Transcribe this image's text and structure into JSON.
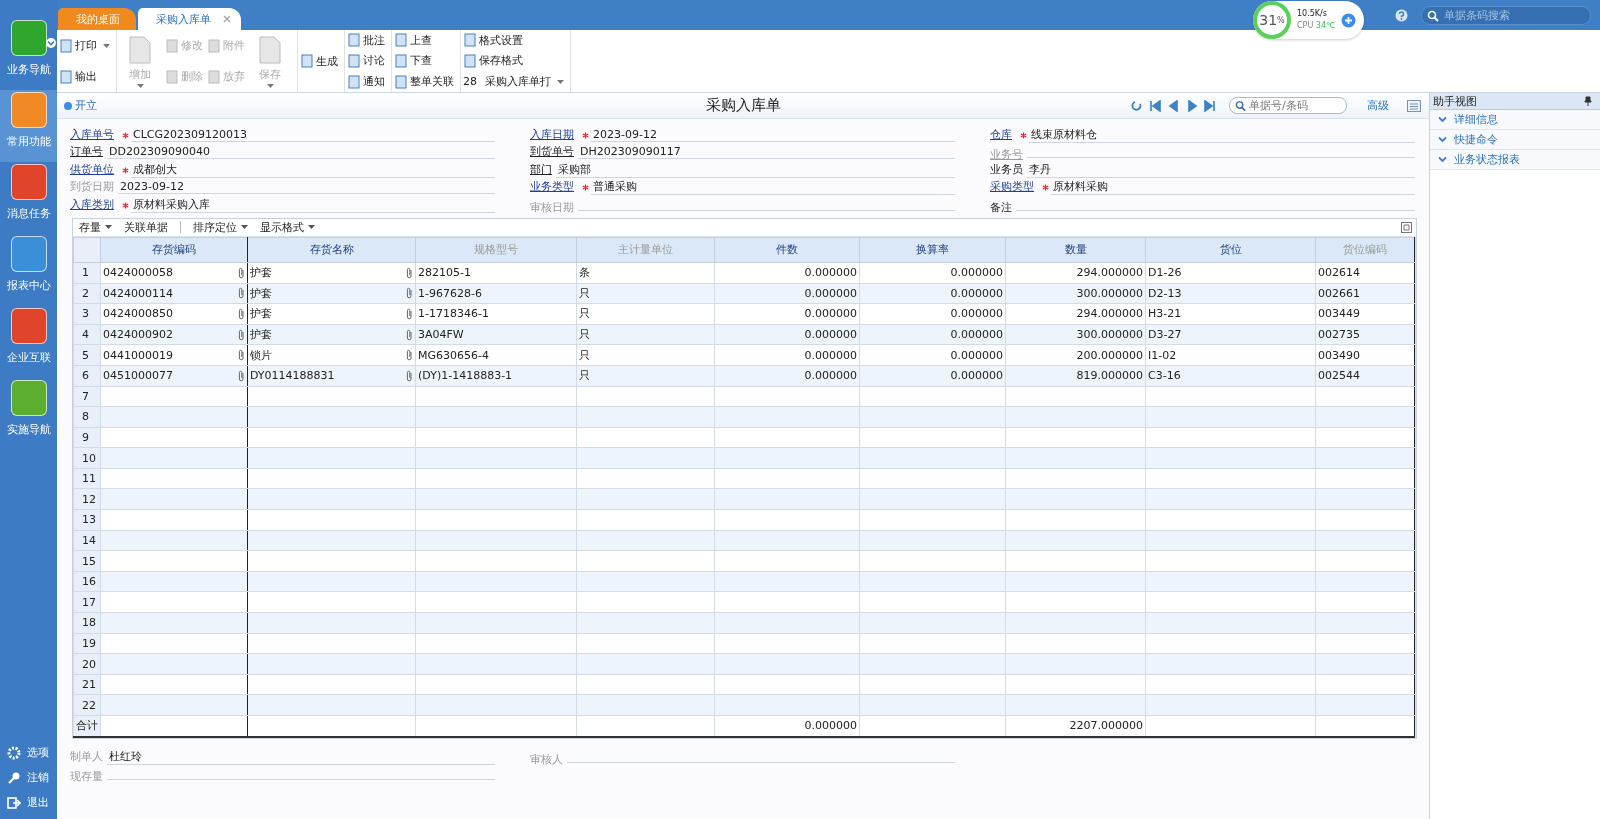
{
  "sidebar": {
    "items": [
      {
        "label": "业务导航",
        "color": "#2fa72f",
        "selected": false
      },
      {
        "label": "常用功能",
        "color": "#f08a24",
        "selected": true
      },
      {
        "label": "消息任务",
        "color": "#e0452c",
        "selected": false
      },
      {
        "label": "报表中心",
        "color": "#3a8fd8",
        "selected": false
      },
      {
        "label": "企业互联",
        "color": "#e0452c",
        "selected": false
      },
      {
        "label": "实施导航",
        "color": "#5cae2e",
        "selected": false
      }
    ],
    "bottom": [
      {
        "label": "选项"
      },
      {
        "label": "注销"
      },
      {
        "label": "退出"
      }
    ]
  },
  "tabs": [
    {
      "label": "我的桌面",
      "selected": false,
      "closable": false
    },
    {
      "label": "采购入库单",
      "selected": true,
      "closable": true
    }
  ],
  "monitor": {
    "percent": "31",
    "unit": "%",
    "speed": "10.5K/s",
    "cpu_label": "CPU",
    "temperature": "34℃"
  },
  "global_search": {
    "placeholder": "单据条码搜索"
  },
  "toolbar": [
    [
      [
        {
          "label": "打印",
          "disabled": false,
          "dropdown": true,
          "kind": "small"
        },
        {
          "label": "输出",
          "disabled": false,
          "dropdown": false,
          "kind": "small"
        }
      ]
    ],
    [
      [
        {
          "label": "增加",
          "disabled": true,
          "dropdown": true,
          "kind": "large"
        }
      ],
      [
        {
          "label": "修改",
          "disabled": true,
          "dropdown": false,
          "kind": "small"
        },
        {
          "label": "删除",
          "disabled": true,
          "dropdown": false,
          "kind": "small"
        }
      ],
      [
        {
          "label": "附件",
          "disabled": true,
          "dropdown": false,
          "kind": "small"
        },
        {
          "label": "放弃",
          "disabled": true,
          "dropdown": false,
          "kind": "small"
        }
      ],
      [
        {
          "label": "保存",
          "disabled": true,
          "dropdown": true,
          "kind": "large"
        }
      ]
    ],
    [
      [
        {
          "label": "生成",
          "disabled": false,
          "dropdown": false,
          "kind": "small"
        }
      ]
    ],
    [
      [
        {
          "label": "批注",
          "disabled": false,
          "dropdown": false,
          "kind": "small"
        },
        {
          "label": "讨论",
          "disabled": false,
          "dropdown": false,
          "kind": "small"
        },
        {
          "label": "通知",
          "disabled": false,
          "dropdown": false,
          "kind": "small"
        }
      ]
    ],
    [
      [
        {
          "label": "上查",
          "disabled": false,
          "dropdown": false,
          "kind": "small"
        },
        {
          "label": "下查",
          "disabled": false,
          "dropdown": false,
          "kind": "small"
        },
        {
          "label": "整单关联",
          "disabled": false,
          "dropdown": false,
          "kind": "small"
        }
      ]
    ],
    [
      [
        {
          "label": "格式设置",
          "disabled": false,
          "dropdown": false,
          "kind": "small"
        },
        {
          "label": "保存格式",
          "disabled": false,
          "dropdown": false,
          "kind": "small"
        },
        {
          "label": "采购入库单打",
          "prefix": "28",
          "dropdown": true,
          "kind": "select"
        }
      ]
    ]
  ],
  "document": {
    "status": "开立",
    "title": "采购入库单",
    "search_placeholder": "单据号/条码",
    "advanced": "高级"
  },
  "form": [
    [
      {
        "label": "入库单号",
        "kind": "link",
        "required": true,
        "value": "CLCG202309120013"
      },
      {
        "label": "订单号",
        "kind": "underline",
        "required": false,
        "value": "DD202309090040"
      },
      {
        "label": "供货单位",
        "kind": "link",
        "required": true,
        "value": "成都创大"
      },
      {
        "label": "到货日期",
        "kind": "muted",
        "required": false,
        "value": "2023-09-12"
      },
      {
        "label": "入库类别",
        "kind": "link",
        "required": true,
        "value": "原材料采购入库"
      }
    ],
    [
      {
        "label": "入库日期",
        "kind": "link",
        "required": true,
        "value": "2023-09-12"
      },
      {
        "label": "到货单号",
        "kind": "underline",
        "required": false,
        "value": "DH202309090117"
      },
      {
        "label": "部门",
        "kind": "underline",
        "required": false,
        "value": "采购部"
      },
      {
        "label": "业务类型",
        "kind": "link",
        "required": true,
        "value": "普通采购"
      },
      {
        "label": "审核日期",
        "kind": "muted",
        "required": false
      }
    ],
    [
      {
        "label": "仓库",
        "kind": "link",
        "required": true,
        "value": "线束原材料仓"
      },
      {
        "label": "业务号",
        "kind": "muted-underline",
        "required": false
      },
      {
        "label": "业务员",
        "kind": "plain",
        "required": false,
        "value": "李丹"
      },
      {
        "label": "采购类型",
        "kind": "link",
        "required": true,
        "value": "原材料采购"
      },
      {
        "label": "备注",
        "kind": "plain",
        "required": false
      }
    ]
  ],
  "grid_toolbar": [
    {
      "label": "存量",
      "dropdown": true
    },
    {
      "label": "关联单据",
      "dropdown": false
    },
    {
      "label": "排序定位",
      "dropdown": true
    },
    {
      "label": "显示格式",
      "dropdown": true
    }
  ],
  "table": {
    "columns": [
      {
        "label": "存货编码",
        "muted": false
      },
      {
        "label": "存货名称",
        "muted": false
      },
      {
        "label": "规格型号",
        "muted": true
      },
      {
        "label": "主计量单位",
        "muted": true
      },
      {
        "label": "件数",
        "muted": false
      },
      {
        "label": "换算率",
        "muted": false
      },
      {
        "label": "数量",
        "muted": false
      },
      {
        "label": "货位",
        "muted": false
      },
      {
        "label": "货位编码",
        "muted": true
      }
    ],
    "rows": [
      {
        "no": "1",
        "cells": [
          "0424000058",
          "护套",
          "282105-1",
          "条",
          "0.000000",
          "0.000000",
          "294.000000",
          "D1-26",
          "002614"
        ]
      },
      {
        "no": "2",
        "cells": [
          "0424000114",
          "护套",
          "1-967628-6",
          "只",
          "0.000000",
          "0.000000",
          "300.000000",
          "D2-13",
          "002661"
        ]
      },
      {
        "no": "3",
        "cells": [
          "0424000850",
          "护套",
          "1-1718346-1",
          "只",
          "0.000000",
          "0.000000",
          "294.000000",
          "H3-21",
          "003449"
        ]
      },
      {
        "no": "4",
        "cells": [
          "0424000902",
          "护套",
          "3A04FW",
          "只",
          "0.000000",
          "0.000000",
          "300.000000",
          "D3-27",
          "002735"
        ]
      },
      {
        "no": "5",
        "cells": [
          "0441000019",
          "锁片",
          "MG630656-4",
          "只",
          "0.000000",
          "0.000000",
          "200.000000",
          "I1-02",
          "003490"
        ]
      },
      {
        "no": "6",
        "cells": [
          "0451000077",
          "DY0114188831",
          "(DY)1-1418883-1",
          "只",
          "0.000000",
          "0.000000",
          "819.000000",
          "C3-16",
          "002544"
        ]
      },
      {
        "no": "7"
      },
      {
        "no": "8"
      },
      {
        "no": "9"
      },
      {
        "no": "10"
      },
      {
        "no": "11"
      },
      {
        "no": "12"
      },
      {
        "no": "13"
      },
      {
        "no": "14"
      },
      {
        "no": "15"
      },
      {
        "no": "16"
      },
      {
        "no": "17"
      },
      {
        "no": "18"
      },
      {
        "no": "19"
      },
      {
        "no": "20"
      },
      {
        "no": "21"
      },
      {
        "no": "22"
      }
    ],
    "total": {
      "label": "合计",
      "cells": {
        "4": "0.000000",
        "6": "2207.000000"
      }
    }
  },
  "footer": [
    {
      "label": "制单人",
      "value": "杜红玲"
    },
    {
      "label": "审核人"
    },
    {
      "label": "现存量"
    }
  ],
  "helper": {
    "title": "助手视图",
    "items": [
      {
        "label": "详细信息"
      },
      {
        "label": "快捷命令"
      },
      {
        "label": "业务状态报表"
      }
    ]
  }
}
